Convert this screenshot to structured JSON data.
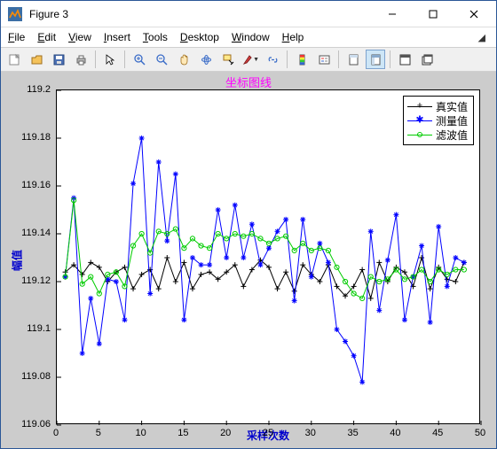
{
  "window": {
    "title": "Figure 3"
  },
  "menu": {
    "file": "File",
    "edit": "Edit",
    "view": "View",
    "insert": "Insert",
    "tools": "Tools",
    "desktop": "Desktop",
    "window": "Window",
    "help": "Help"
  },
  "chart_data": {
    "type": "line",
    "title": "坐标图线",
    "xlabel": "采样次数",
    "ylabel": "幅值",
    "xlim": [
      0,
      50
    ],
    "ylim": [
      119.06,
      119.2
    ],
    "xticks": [
      0,
      5,
      10,
      15,
      20,
      25,
      30,
      35,
      40,
      45,
      50
    ],
    "yticks": [
      119.06,
      119.08,
      119.1,
      119.12,
      119.14,
      119.16,
      119.18,
      119.2
    ],
    "x": [
      1,
      2,
      3,
      4,
      5,
      6,
      7,
      8,
      9,
      10,
      11,
      12,
      13,
      14,
      15,
      16,
      17,
      18,
      19,
      20,
      21,
      22,
      23,
      24,
      25,
      26,
      27,
      28,
      29,
      30,
      31,
      32,
      33,
      34,
      35,
      36,
      37,
      38,
      39,
      40,
      41,
      42,
      43,
      44,
      45,
      46,
      47,
      48
    ],
    "series": [
      {
        "name": "真实值",
        "color": "#000000",
        "marker": "+",
        "values": [
          119.124,
          119.127,
          119.123,
          119.128,
          119.126,
          119.12,
          119.124,
          119.126,
          119.117,
          119.123,
          119.125,
          119.117,
          119.13,
          119.12,
          119.128,
          119.117,
          119.123,
          119.124,
          119.121,
          119.124,
          119.127,
          119.118,
          119.125,
          119.129,
          119.126,
          119.117,
          119.124,
          119.116,
          119.127,
          119.123,
          119.12,
          119.127,
          119.118,
          119.114,
          119.118,
          119.125,
          119.113,
          119.128,
          119.12,
          119.126,
          119.124,
          119.118,
          119.13,
          119.117,
          119.126,
          119.121,
          119.12,
          119.128
        ]
      },
      {
        "name": "测量值",
        "color": "#0000ff",
        "marker": "*",
        "values": [
          119.122,
          119.155,
          119.09,
          119.113,
          119.094,
          119.121,
          119.12,
          119.104,
          119.161,
          119.18,
          119.115,
          119.17,
          119.137,
          119.165,
          119.104,
          119.13,
          119.127,
          119.127,
          119.15,
          119.13,
          119.152,
          119.13,
          119.144,
          119.127,
          119.134,
          119.141,
          119.146,
          119.112,
          119.146,
          119.122,
          119.136,
          119.128,
          119.1,
          119.095,
          119.089,
          119.078,
          119.141,
          119.108,
          119.129,
          119.148,
          119.104,
          119.122,
          119.135,
          119.103,
          119.143,
          119.118,
          119.13,
          119.128
        ]
      },
      {
        "name": "滤波值",
        "color": "#00cc00",
        "marker": "o",
        "values": [
          119.122,
          119.154,
          119.119,
          119.122,
          119.115,
          119.123,
          119.124,
          119.118,
          119.135,
          119.14,
          119.132,
          119.141,
          119.14,
          119.142,
          119.134,
          119.138,
          119.135,
          119.134,
          119.14,
          119.138,
          119.14,
          119.139,
          119.14,
          119.138,
          119.136,
          119.138,
          119.139,
          119.133,
          119.136,
          119.133,
          119.134,
          119.133,
          119.126,
          119.12,
          119.115,
          119.113,
          119.122,
          119.12,
          119.121,
          119.125,
          119.121,
          119.122,
          119.125,
          119.12,
          119.125,
          119.123,
          119.125,
          119.125
        ]
      }
    ],
    "legend_position": "northeast"
  }
}
